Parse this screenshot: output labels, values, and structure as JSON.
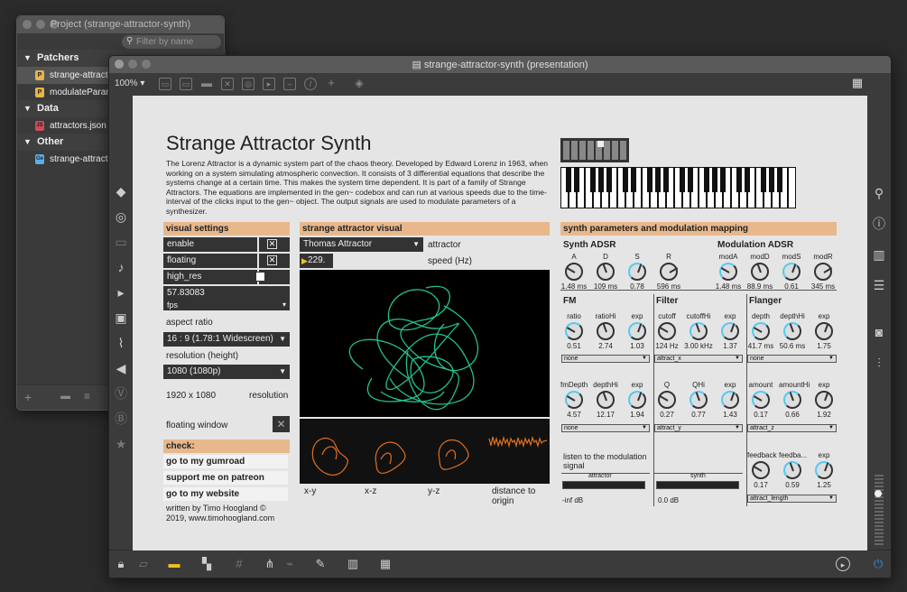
{
  "project": {
    "title": "Project (strange-attractor-synth)",
    "filter_placeholder": "Filter by name",
    "sections": [
      {
        "label": "Patchers",
        "items": [
          {
            "name": "strange-attractor",
            "icon": "P",
            "color": "#e6b54a"
          },
          {
            "name": "modulateParam.m",
            "icon": "P",
            "color": "#e6b54a"
          }
        ]
      },
      {
        "label": "Data",
        "items": [
          {
            "name": "attractors.json",
            "icon": "JS",
            "color": "#d04a5a"
          }
        ]
      },
      {
        "label": "Other",
        "items": [
          {
            "name": "strange-attractors",
            "icon": "Ge",
            "color": "#5ab0e6"
          }
        ]
      }
    ]
  },
  "window": {
    "title": "strange-attractor-synth (presentation)",
    "zoom": "100%"
  },
  "title": "Strange Attractor Synth",
  "description": "The Lorenz Attractor is a dynamic system part of the chaos theory. Developed by Edward Lorenz in 1963, when working on a system simulating atmospheric convection. It consists of 3 differential equations that describe the systems change at a certain time. This makes the system time dependent. It is part of a family of Strange Attractors. The equations are implemented in the gen~ codebox and can run at various speeds due to the time-interval of the clicks input to the gen~ object. The output signals are used to modulate parameters of a synthesizer.",
  "visual_settings": {
    "header": "visual settings",
    "enable": "enable",
    "floating": "floating",
    "high_res": "high_res",
    "fps_value": "57.83083",
    "fps_label": "fps",
    "aspect_label": "aspect ratio",
    "aspect_value": "16 : 9 (1.78:1 Widescreen)",
    "res_label": "resolution (height)",
    "res_value": "1080 (1080p)",
    "res_dims": "1920 x 1080",
    "res_word": "resolution",
    "floating_window": "floating window"
  },
  "check": {
    "header": "check:",
    "links": [
      "go to my gumroad",
      "support me on patreon",
      "go to my website"
    ],
    "credit1": "written by Timo Hoogland ©",
    "credit2": "2019, www.timohoogland.com"
  },
  "visual": {
    "header": "strange attractor visual",
    "attractor": "Thomas Attractor",
    "attractor_label": "attractor",
    "speed": "229.",
    "speed_label": "speed (Hz)",
    "xy": "x-y",
    "xz": "x-z",
    "yz": "y-z",
    "dist": "distance to origin"
  },
  "synth": {
    "header": "synth parameters and modulation mapping",
    "adsr_title": "Synth ADSR",
    "mod_title": "Modulation ADSR",
    "adsr": [
      {
        "l": "A",
        "v": "1.48 ms"
      },
      {
        "l": "D",
        "v": "109 ms"
      },
      {
        "l": "S",
        "v": "0.78"
      },
      {
        "l": "R",
        "v": "596 ms"
      }
    ],
    "mod": [
      {
        "l": "modA",
        "v": "1.48 ms"
      },
      {
        "l": "modD",
        "v": "88.9 ms"
      },
      {
        "l": "modS",
        "v": "0.61"
      },
      {
        "l": "modR",
        "v": "345 ms"
      }
    ],
    "fm_title": "FM",
    "filter_title": "Filter",
    "flanger_title": "Flanger",
    "fm1": [
      {
        "l": "ratio",
        "v": "0.51"
      },
      {
        "l": "ratioHi",
        "v": "2.74"
      },
      {
        "l": "exp",
        "v": "1.03"
      }
    ],
    "filter1": [
      {
        "l": "cutoff",
        "v": "124 Hz"
      },
      {
        "l": "cutoffHi",
        "v": "3.00 kHz"
      },
      {
        "l": "exp",
        "v": "1.37"
      }
    ],
    "flanger1": [
      {
        "l": "depth",
        "v": "41.7 ms"
      },
      {
        "l": "depthHi",
        "v": "50.6 ms"
      },
      {
        "l": "exp",
        "v": "1.75"
      }
    ],
    "fm2": [
      {
        "l": "fmDepth",
        "v": "4.57"
      },
      {
        "l": "depthHi",
        "v": "12.17"
      },
      {
        "l": "exp",
        "v": "1.94"
      }
    ],
    "filter2": [
      {
        "l": "Q",
        "v": "0.27"
      },
      {
        "l": "QHi",
        "v": "0.77"
      },
      {
        "l": "exp",
        "v": "1.43"
      }
    ],
    "flanger2": [
      {
        "l": "amount",
        "v": "0.17"
      },
      {
        "l": "amountHi",
        "v": "0.66"
      },
      {
        "l": "exp",
        "v": "1.92"
      }
    ],
    "flanger3": [
      {
        "l": "feedback",
        "v": "0.17"
      },
      {
        "l": "feedba...",
        "v": "0.59"
      },
      {
        "l": "exp",
        "v": "1.25"
      }
    ],
    "menus": {
      "fm1": "none",
      "filter1": "attract_x",
      "flanger1": "none",
      "fm2": "none",
      "filter2": "attract_y",
      "flanger2": "attract_z",
      "flanger3": "attract_length"
    },
    "listen": "listen to the modulation signal",
    "attractor_meter": "attractor",
    "synth_meter": "synth",
    "inf": "-inf dB",
    "zero": "0.0 dB"
  }
}
